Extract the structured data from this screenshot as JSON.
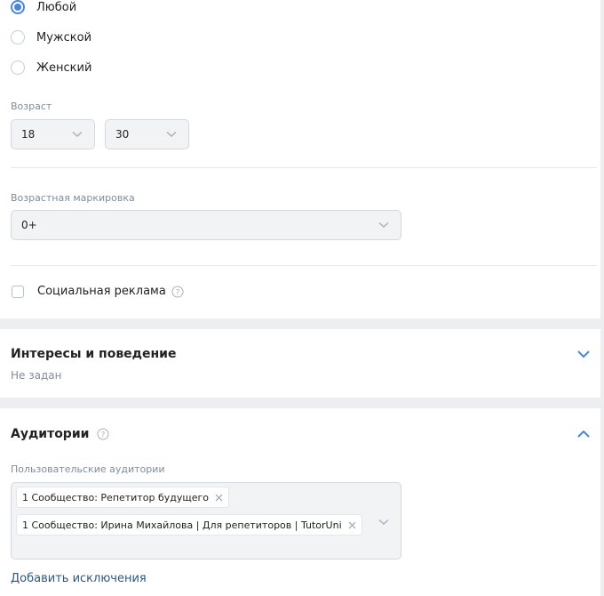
{
  "gender": {
    "options": [
      {
        "label": "Любой",
        "checked": true
      },
      {
        "label": "Мужской",
        "checked": false
      },
      {
        "label": "Женский",
        "checked": false
      }
    ]
  },
  "age": {
    "label": "Возраст",
    "from": "18",
    "to": "30"
  },
  "age_marking": {
    "label": "Возрастная маркировка",
    "value": "0+"
  },
  "social_ad": {
    "label": "Социальная реклама",
    "checked": false,
    "icon": "help-icon"
  },
  "interests": {
    "title": "Интересы и поведение",
    "status": "Не задан",
    "icon": "chevron-down-icon"
  },
  "audiences": {
    "title": "Аудитории",
    "icon": "chevron-up-icon",
    "field_label": "Пользовательские аудитории",
    "chips": [
      "1 Сообщество: Репетитор будущего",
      "1 Сообщество: Ирина Михайлова | Для репетиторов | TutorUni"
    ],
    "add_exclusions": "Добавить исключения"
  },
  "colors": {
    "accent": "#4a86d8",
    "link": "#2a5885",
    "muted": "#818c99",
    "background": "#edeef0"
  }
}
